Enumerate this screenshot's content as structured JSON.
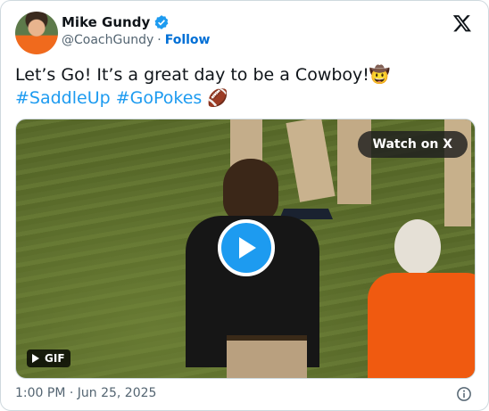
{
  "author": {
    "name": "Mike Gundy",
    "handle": "@CoachGundy",
    "separator": "·",
    "follow_label": "Follow"
  },
  "tweet": {
    "text": "Let’s Go! It’s a great day to be a Cowboy!🤠",
    "hashtag1": "#SaddleUp",
    "hashtag2": "#GoPokes",
    "hashtag_emoji": "🏈"
  },
  "media": {
    "watch_label": "Watch on X",
    "gif_label": "GIF"
  },
  "footer": {
    "timestamp": "1:00 PM · Jun 25, 2025"
  },
  "colors": {
    "accent": "#1d9bf0",
    "follow": "#006fd6",
    "secondary_text": "#536471"
  },
  "icons": [
    "verified-badge-icon",
    "x-logo-icon",
    "play-icon",
    "gif-play-icon",
    "info-icon"
  ]
}
